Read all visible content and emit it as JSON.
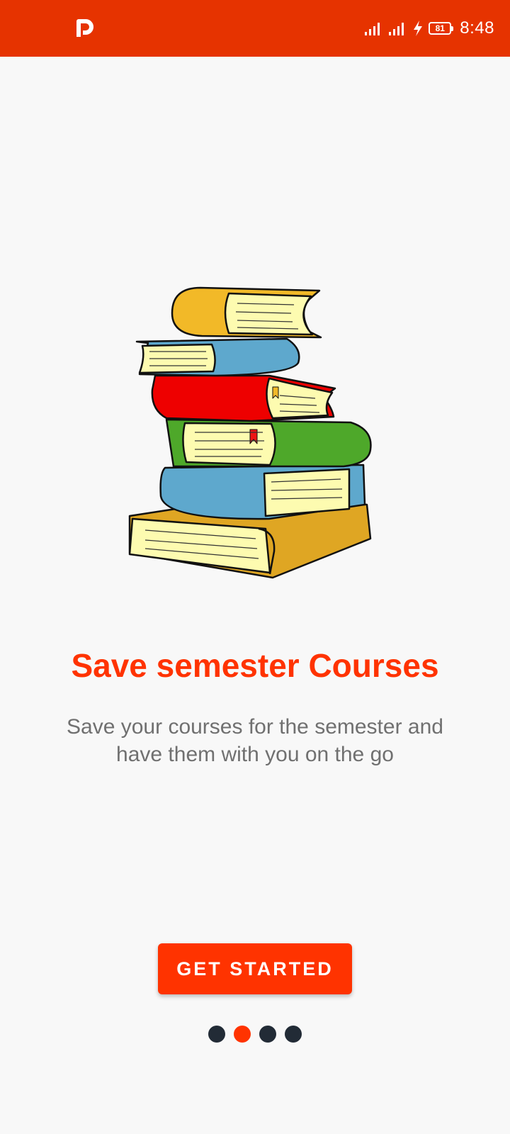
{
  "status_bar": {
    "time": "8:48",
    "battery_level": "81",
    "icons": [
      "app-p-icon",
      "signal-icon",
      "signal-icon",
      "charging-bolt-icon",
      "battery-icon"
    ]
  },
  "onboarding": {
    "illustration": "stack-of-books-illustration",
    "title": "Save semester Courses",
    "subtitle": "Save your courses for the semester and have them with you on the go",
    "cta_label": "GET STARTED",
    "page_count": 4,
    "active_page": 2
  },
  "colors": {
    "status_bar": "#e63300",
    "accent": "#ff3300",
    "dot_inactive": "#222b36",
    "subtitle_text": "#707070",
    "background": "#f8f8f8"
  }
}
